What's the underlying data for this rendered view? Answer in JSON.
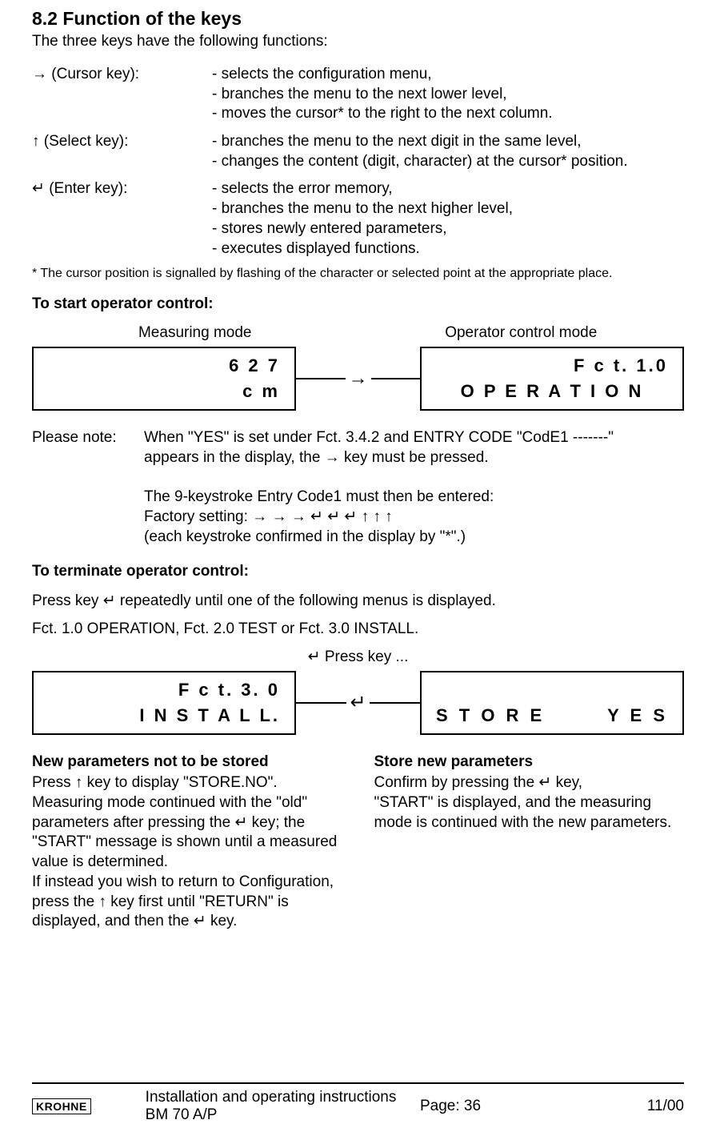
{
  "section": {
    "number": "8.2",
    "title": "Function of the keys"
  },
  "intro": "The three keys have the following functions:",
  "keys": [
    {
      "symbol": "→",
      "name": "(Cursor key):",
      "lines": [
        "- selects the configuration menu,",
        "- branches the menu to the next lower level,",
        "- moves the cursor* to the right to the next column."
      ]
    },
    {
      "symbol": "↑",
      "name": "(Select key):",
      "lines": [
        "- branches the menu to the next digit in the same level,",
        "- changes the content (digit, character) at the cursor* position."
      ]
    },
    {
      "symbol": "↵",
      "name": "(Enter key):",
      "lines": [
        "- selects the error memory,",
        "- branches the menu to the next higher level,",
        "- stores newly entered parameters,",
        "- executes displayed functions."
      ]
    }
  ],
  "footnote": "* The cursor position is signalled by flashing of the character or selected point at the appropriate place.",
  "start_heading": "To start operator control:",
  "modes": {
    "left": "Measuring mode",
    "right": "Operator control mode"
  },
  "diagram1": {
    "left": {
      "line1": "6 2 7",
      "line2": "c m"
    },
    "arrow": "→",
    "right": {
      "line1": "F c t.  1.0",
      "line2": "O P E R A T I O N"
    }
  },
  "please_note": {
    "label": "Please note:",
    "p1_a": "When \"YES\" is set under Fct. 3.4.2 and ENTRY CODE \"CodE1 -------\"",
    "p1_b": "appears in the display, the → key must be pressed.",
    "p2_a": "The 9-keystroke Entry Code1 must then be entered:",
    "p2_b": "Factory setting: → → → ↵ ↵ ↵ ↑ ↑ ↑",
    "p2_c": "(each keystroke confirmed in the display by \"*\".)"
  },
  "terminate_heading": "To terminate operator control:",
  "terminate_p1": "Press key ↵ repeatedly until one of the following menus is displayed.",
  "terminate_p2": "Fct. 1.0 OPERATION, Fct. 2.0 TEST or Fct. 3.0 INSTALL.",
  "presskey": "↵ Press key ...",
  "diagram2": {
    "left": {
      "line1": "F  c  t.   3.  0",
      "line2": "I N S T A L L."
    },
    "arrow": "↵",
    "right": {
      "store": "S T O R E",
      "yes": "Y E S"
    }
  },
  "cols": {
    "left": {
      "head": "New parameters not to be stored",
      "body": "Press ↑ key to display \"STORE.NO\". Measuring mode continued with the \"old\" parameters after pressing the ↵ key; the \"START\" message is shown until a measured value is determined.\nIf instead you wish to return to Configuration, press the ↑ key first until \"RETURN\" is displayed, and then the ↵ key."
    },
    "right": {
      "head": "Store new parameters",
      "body": "Confirm by pressing the ↵ key,\n\"START\" is displayed, and the measuring mode is continued with the new parameters."
    }
  },
  "footer": {
    "logo": "KROHNE",
    "title": "Installation and operating instructions BM 70 A/P",
    "page": "Page: 36",
    "date": "11/00"
  }
}
